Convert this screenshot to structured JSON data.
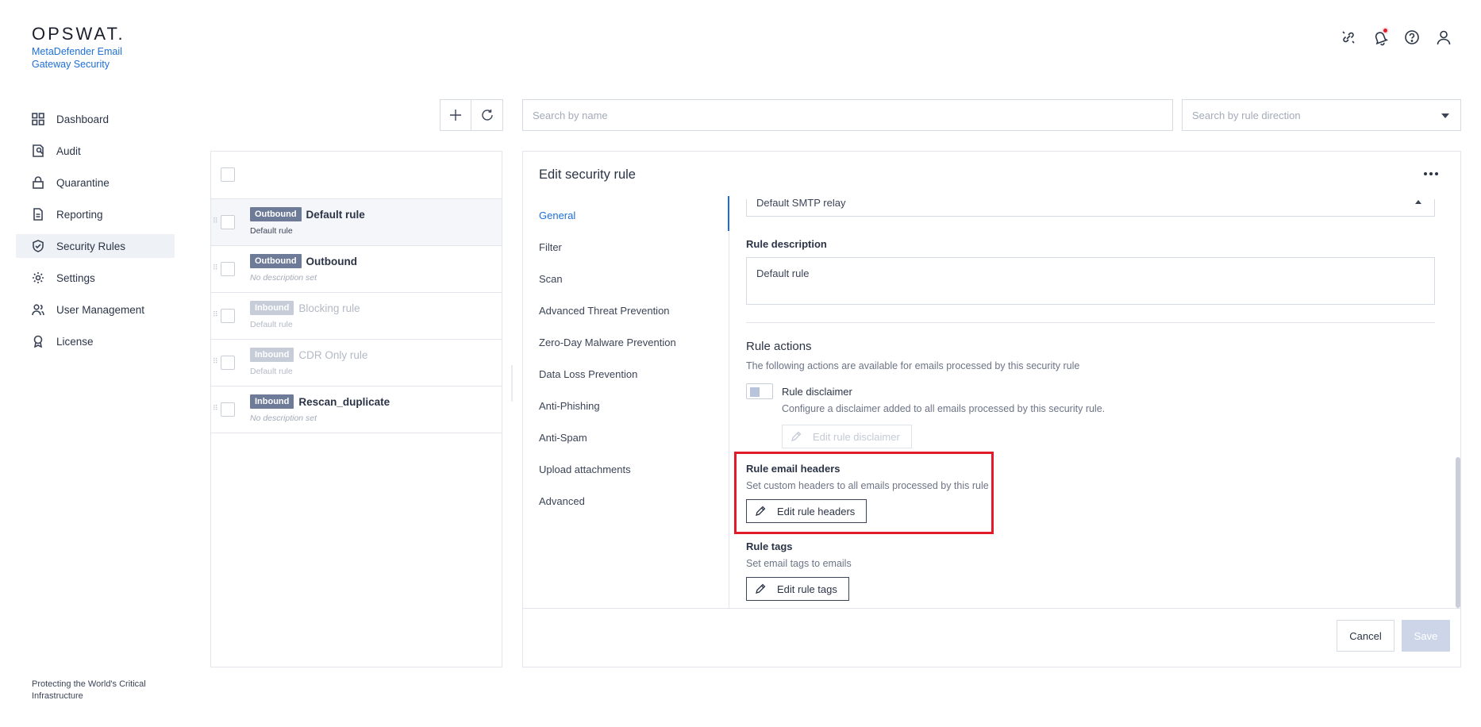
{
  "brand": {
    "logo": "OPSWAT.",
    "product": "MetaDefender Email Gateway Security",
    "footer": "Protecting the World's Critical Infrastructure"
  },
  "nav": [
    {
      "label": "Dashboard",
      "icon": "dashboard-icon"
    },
    {
      "label": "Audit",
      "icon": "audit-icon"
    },
    {
      "label": "Quarantine",
      "icon": "lock-icon"
    },
    {
      "label": "Reporting",
      "icon": "report-icon"
    },
    {
      "label": "Security Rules",
      "icon": "shield-check-icon",
      "active": true
    },
    {
      "label": "Settings",
      "icon": "gear-icon"
    },
    {
      "label": "User Management",
      "icon": "users-icon"
    },
    {
      "label": "License",
      "icon": "license-icon"
    }
  ],
  "toolbar": {
    "search_name_placeholder": "Search by name",
    "search_direction_placeholder": "Search by rule direction"
  },
  "rules": [
    {
      "direction": "Outbound",
      "name": "Default rule",
      "description": "Default rule",
      "selected": true,
      "disabled": false
    },
    {
      "direction": "Outbound",
      "name": "Outbound",
      "description": "No description set",
      "selected": false,
      "disabled": false
    },
    {
      "direction": "Inbound",
      "name": "Blocking rule",
      "description": "Default rule",
      "selected": false,
      "disabled": true
    },
    {
      "direction": "Inbound",
      "name": "CDR Only rule",
      "description": "Default rule",
      "selected": false,
      "disabled": true
    },
    {
      "direction": "Inbound",
      "name": "Rescan_duplicate",
      "description": "No description set",
      "selected": false,
      "disabled": false
    }
  ],
  "editor": {
    "title": "Edit security rule",
    "tabs": [
      "General",
      "Filter",
      "Scan",
      "Advanced Threat Prevention",
      "Zero-Day Malware Prevention",
      "Data Loss Prevention",
      "Anti-Phishing",
      "Anti-Spam",
      "Upload attachments",
      "Advanced"
    ],
    "active_tab": "General",
    "relay_value": "Default SMTP relay",
    "rule_description_label": "Rule description",
    "rule_description_value": "Default rule",
    "rule_actions": {
      "title": "Rule actions",
      "subtitle": "The following actions are available for emails processed by this security rule",
      "disclaimer_title": "Rule disclaimer",
      "disclaimer_sub": "Configure a disclaimer added to all emails processed by this security rule.",
      "disclaimer_button": "Edit rule disclaimer",
      "headers_title": "Rule email headers",
      "headers_sub": "Set custom headers to all emails processed by this rule",
      "headers_button": "Edit rule headers",
      "tags_title": "Rule tags",
      "tags_sub": "Set email tags to emails",
      "tags_button": "Edit rule tags"
    },
    "cancel_label": "Cancel",
    "save_label": "Save"
  },
  "colors": {
    "accent": "#1d6fd6",
    "badge": "#6e7b98",
    "highlight": "#e21b2b",
    "save_disabled": "#cdd6e8"
  }
}
